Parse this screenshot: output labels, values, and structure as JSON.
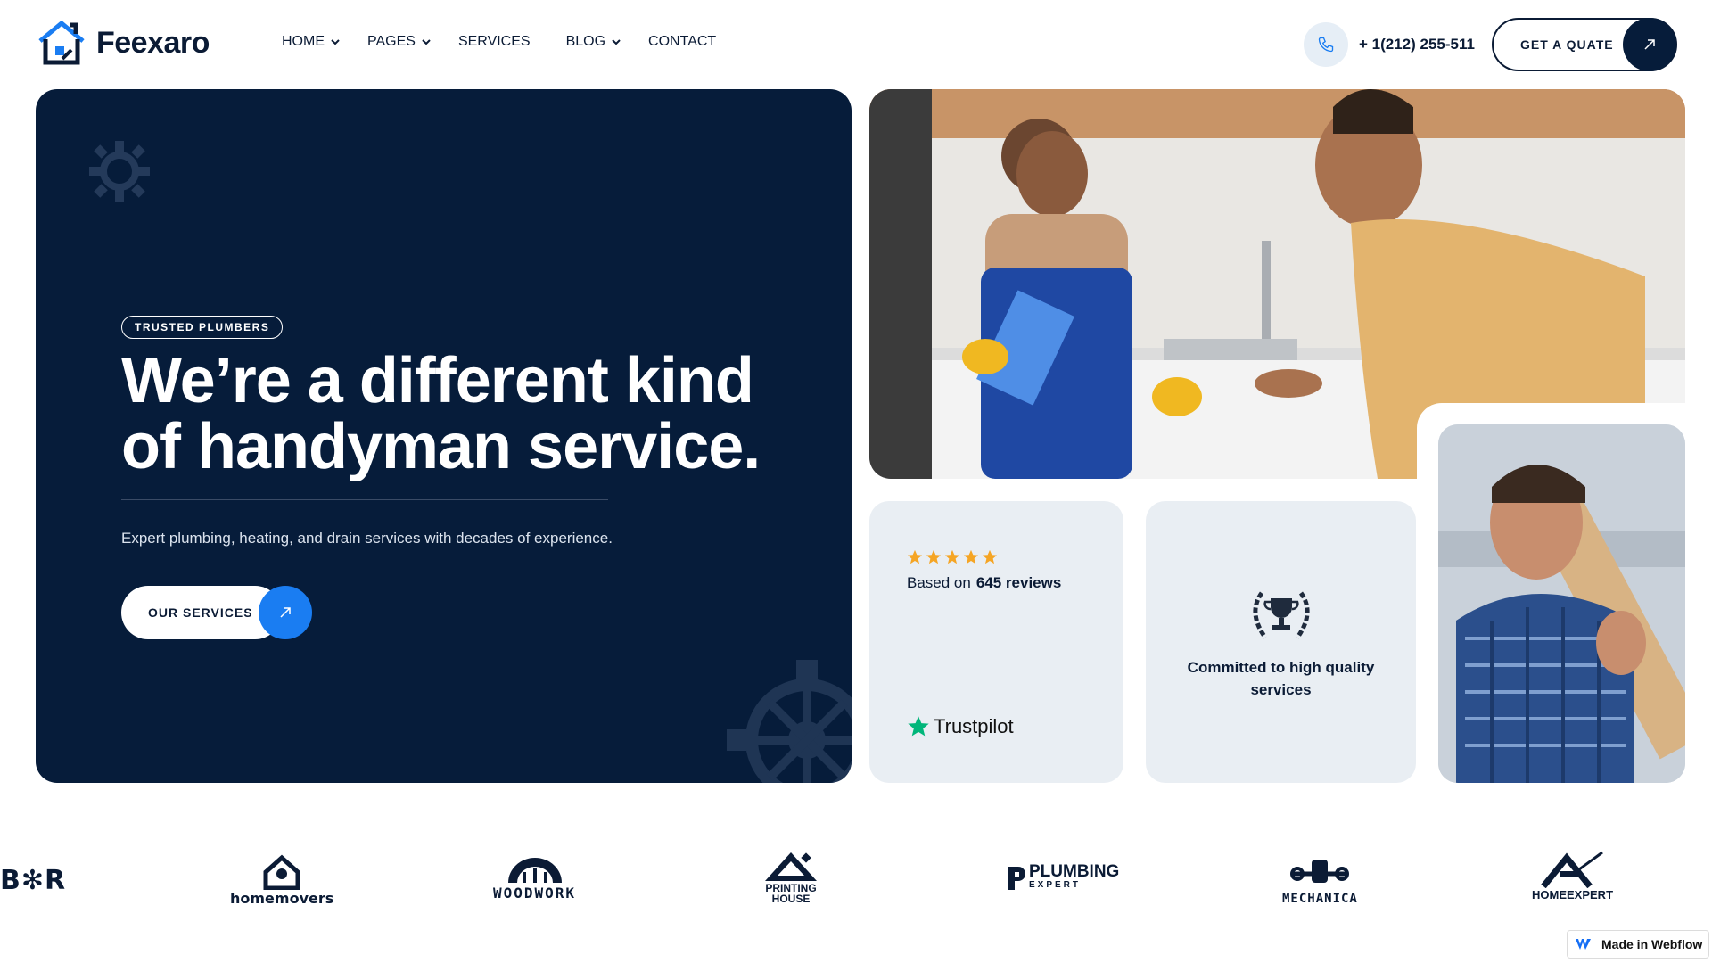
{
  "brand": {
    "name": "Feexaro"
  },
  "nav": {
    "items": [
      {
        "label": "HOME",
        "has_dropdown": true
      },
      {
        "label": "PAGES",
        "has_dropdown": true
      },
      {
        "label": "SERVICES",
        "has_dropdown": false
      },
      {
        "label": "BLOG",
        "has_dropdown": true
      },
      {
        "label": "CONTACT",
        "has_dropdown": false
      }
    ]
  },
  "header": {
    "phone": "+ 1(212) 255-511",
    "quote_label": "GET A QUATE"
  },
  "hero": {
    "badge": "TRUSTED PLUMBERS",
    "title": "We’re a different kind of handyman service.",
    "subtitle": "Expert plumbing, heating, and drain services with decades of experience.",
    "cta_label": "OUR SERVICES"
  },
  "reviews": {
    "rating_stars": 5,
    "prefix": "Based on",
    "count_text": "645 reviews",
    "platform": "Trustpilot"
  },
  "quality": {
    "text": "Committed to high quality services"
  },
  "partners": [
    {
      "name": "B✻R"
    },
    {
      "name": "homemovers"
    },
    {
      "name": "WOODWORK"
    },
    {
      "name": "PRINTING HOUSE"
    },
    {
      "name": "PLUMBING",
      "sub": "EXPERT"
    },
    {
      "name": "MECHANICA"
    },
    {
      "name": "HOMEEXPERT"
    }
  ],
  "badge_webflow": {
    "label": "Made in Webflow"
  },
  "colors": {
    "navy": "#061c3a",
    "accent_blue": "#1a7df2",
    "card_bg": "#e9eef3",
    "star": "#f5a524",
    "trustpilot_green": "#00b67a"
  }
}
